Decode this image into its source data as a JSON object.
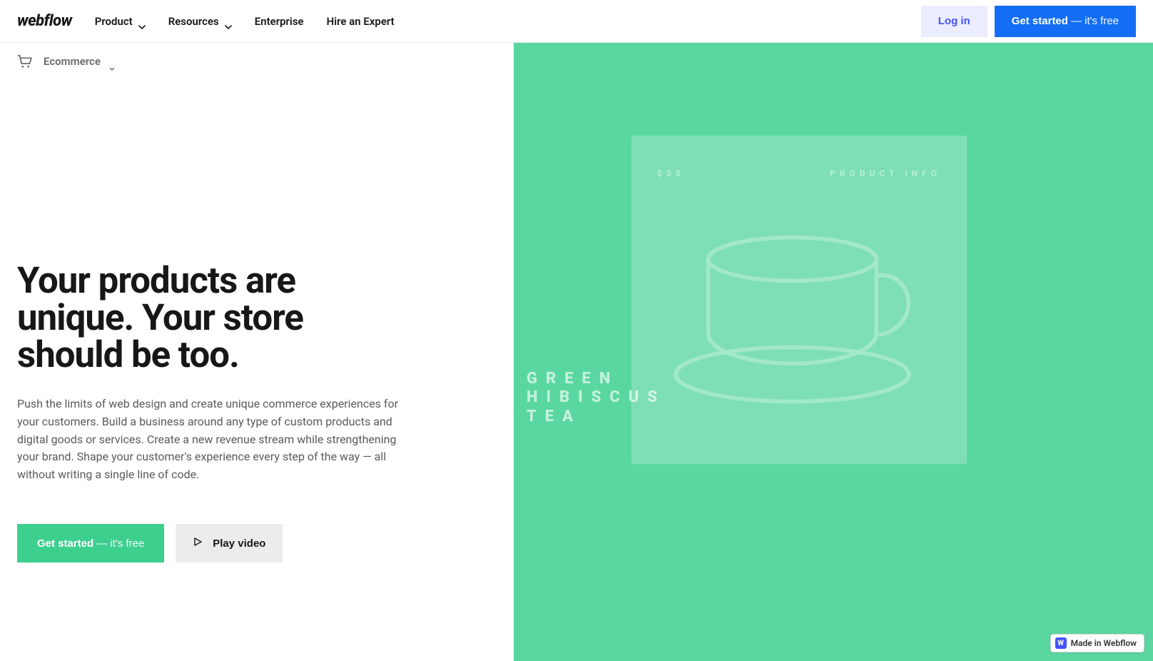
{
  "nav": {
    "logo": "webflow",
    "items": [
      {
        "label": "Product",
        "has_dropdown": true
      },
      {
        "label": "Resources",
        "has_dropdown": true
      },
      {
        "label": "Enterprise",
        "has_dropdown": false
      },
      {
        "label": "Hire an Expert",
        "has_dropdown": false
      }
    ],
    "login_label": "Log in",
    "cta_prefix": "Get started",
    "cta_suffix": "— it's free"
  },
  "subnav": {
    "label": "Ecommerce"
  },
  "hero": {
    "heading": "Your products are unique. Your store should be too.",
    "description": "Push the limits of web design and create unique commerce experiences for your customers. Build a business around any type of custom products and digital goods or services. Create a new revenue stream while strengthening your brand. Shape your customer's experience every step of the way — all without writing a single line of code.",
    "primary_cta_prefix": "Get started",
    "primary_cta_suffix": "— it's free",
    "secondary_cta": "Play video"
  },
  "product_preview": {
    "price": "$35",
    "info_label": "PRODUCT INFO",
    "title_lines": [
      "GREEN",
      "HIBISCUS",
      "TEA"
    ]
  },
  "badge": {
    "label": "Made in Webflow"
  },
  "colors": {
    "accent_blue": "#146ef5",
    "login_bg": "#eceeff",
    "login_text": "#4353ff",
    "green_bg": "#5ad7a0",
    "cta_green": "#3dcf8e"
  }
}
